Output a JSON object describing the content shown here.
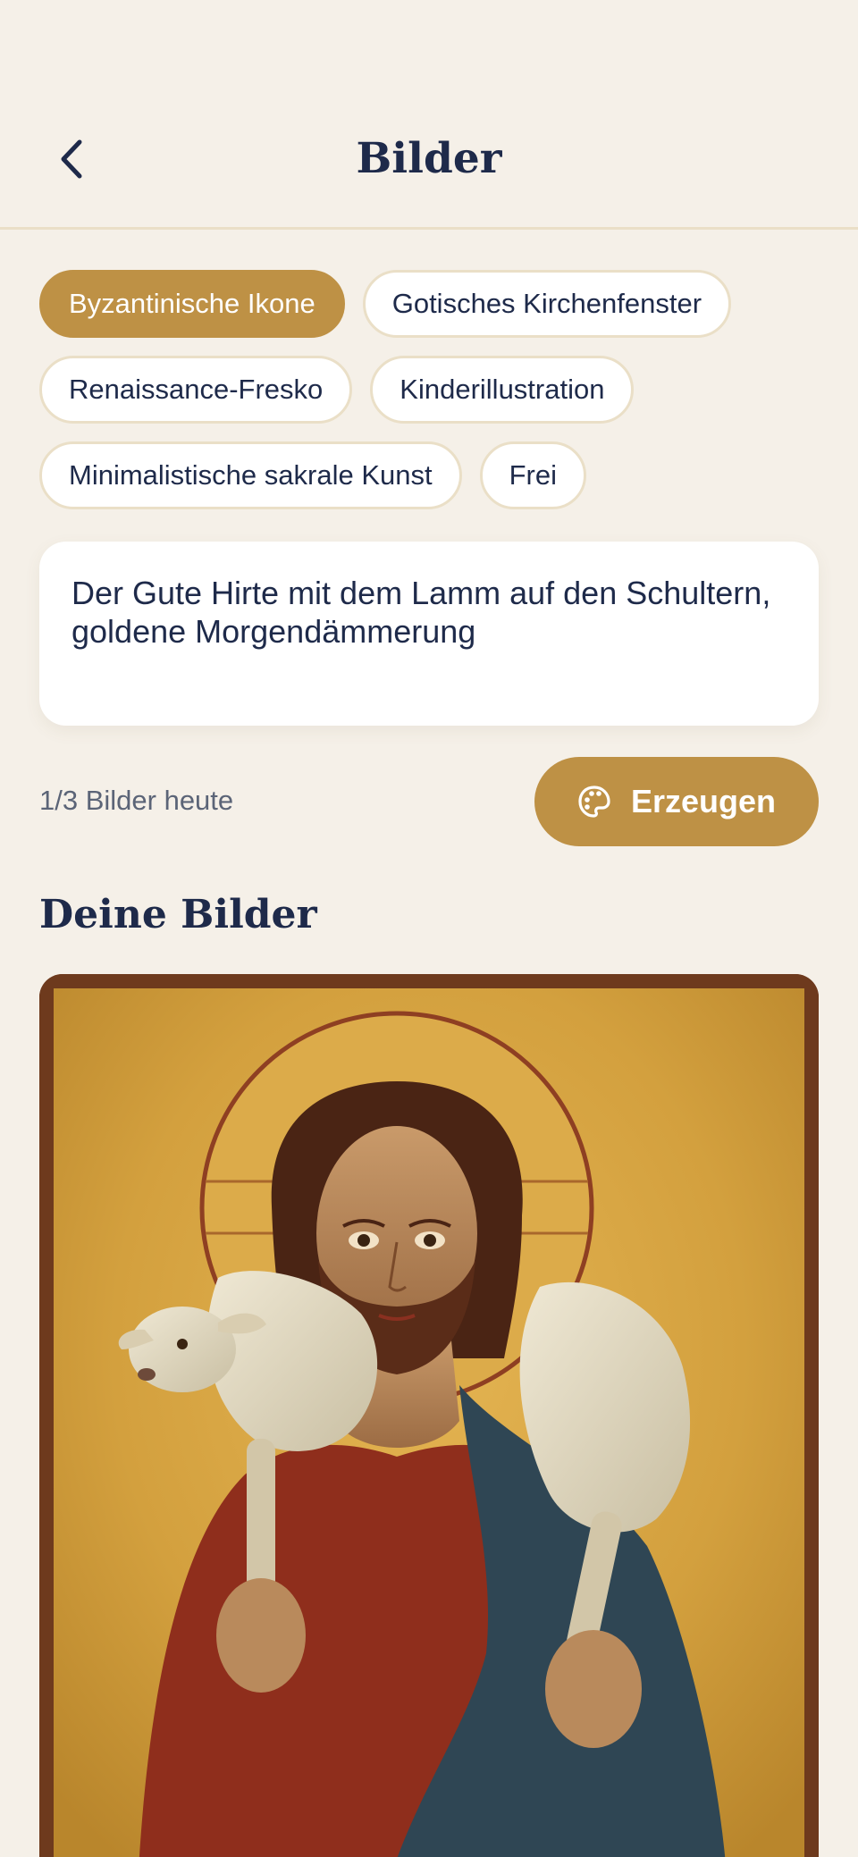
{
  "header": {
    "title": "Bilder",
    "back_icon": "chevron-left-icon"
  },
  "styles": {
    "selected": "Byzantinische Ikone",
    "chips": [
      {
        "label": "Byzantinische Ikone",
        "active": true
      },
      {
        "label": "Gotisches Kirchenfenster",
        "active": false
      },
      {
        "label": "Renaissance-Fresko",
        "active": false
      },
      {
        "label": "Kinderillustration",
        "active": false
      },
      {
        "label": "Minimalistische sakrale Kunst",
        "active": false
      },
      {
        "label": "Frei",
        "active": false
      }
    ]
  },
  "prompt": {
    "value": "Der Gute Hirte mit dem Lamm auf den Schultern, goldene Morgendämmerung"
  },
  "quota": {
    "text": "1/3 Bilder heute"
  },
  "generate": {
    "label": "Erzeugen",
    "icon": "palette-icon"
  },
  "gallery": {
    "title": "Deine Bilder",
    "images": [
      {
        "subject": "good-shepherd-icon-painting"
      }
    ]
  },
  "colors": {
    "background": "#f5f0e8",
    "accent": "#be9145",
    "text": "#1e2a4a",
    "muted": "#5b6477",
    "chip_border": "#eadfc7"
  }
}
